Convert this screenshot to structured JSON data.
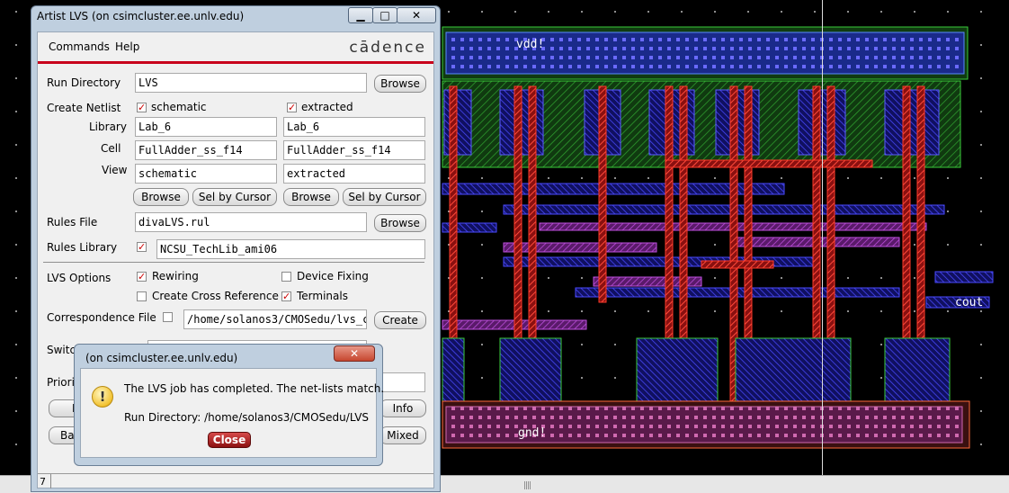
{
  "layout": {
    "vdd_label": "vdd!",
    "gnd_label": "gnd!",
    "cout_label": "cout"
  },
  "window": {
    "title": "Artist LVS (on csimcluster.ee.unlv.edu)",
    "minimize": "▁",
    "maximize": "□",
    "close": "✕"
  },
  "menu": {
    "commands": "Commands",
    "help": "Help",
    "logo": "cādence"
  },
  "form": {
    "run_directory_label": "Run Directory",
    "run_directory_value": "LVS",
    "browse": "Browse",
    "create_netlist_label": "Create Netlist",
    "schematic_check": "schematic",
    "extracted_check": "extracted",
    "library_label": "Library",
    "cell_label": "Cell",
    "view_label": "View",
    "sch_library": "Lab_6",
    "ext_library": "Lab_6",
    "sch_cell": "FullAdder_ss_f14",
    "ext_cell": "FullAdder_ss_f14",
    "sch_view": "schematic",
    "ext_view": "extracted",
    "sel_by_cursor": "Sel by Cursor",
    "rules_file_label": "Rules File",
    "rules_file_value": "divaLVS.rul",
    "rules_library_label": "Rules Library",
    "rules_library_value": "NCSU_TechLib_ami06",
    "lvs_options_label": "LVS Options",
    "rewiring": "Rewiring",
    "device_fixing": "Device Fixing",
    "create_cross_reference": "Create Cross Reference",
    "terminals": "Terminals",
    "correspondence_label": "Correspondence File",
    "correspondence_value": "/home/solanos3/CMOSedu/lvs_c",
    "create": "Create",
    "switch_label": "Switch",
    "priority_label": "Priorit",
    "info": "Info",
    "mixed": "Mixed",
    "ba": "Ba",
    "r": "R",
    "status_number": "7"
  },
  "dialog": {
    "title": "(on csimcluster.ee.unlv.edu)",
    "close_x": "✕",
    "icon": "!",
    "message": "The LVS job has completed. The net-lists match.",
    "run_dir": "Run Directory: /home/solanos3/CMOSedu/LVS",
    "close_button": "Close"
  },
  "colors": {
    "accent_red": "#c8001b",
    "metal1": "#3a3aff",
    "poly": "#e8201a",
    "nwell": "#2c9a2c",
    "active": "#3acb3a"
  }
}
